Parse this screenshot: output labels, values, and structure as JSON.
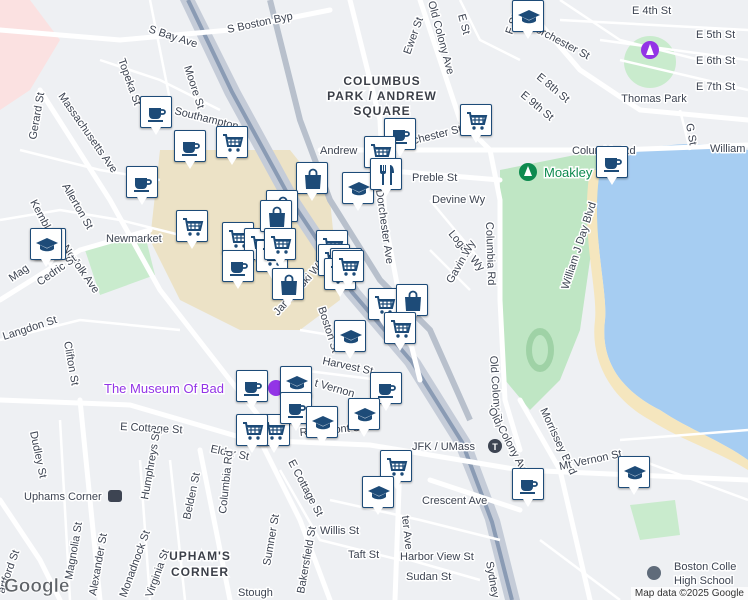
{
  "map": {
    "attribution": "Map data ©2025 Google",
    "logo": "Google",
    "areas": [
      {
        "id": "columbus-park-line1",
        "text": "COLUMBUS"
      },
      {
        "id": "columbus-park-line2",
        "text": "PARK / ANDREW"
      },
      {
        "id": "columbus-park-line3",
        "text": "SQUARE"
      },
      {
        "id": "uphams-corner",
        "text": "UPHAM'S"
      },
      {
        "id": "uphams-corner-2",
        "text": "CORNER"
      }
    ],
    "pois": [
      {
        "id": "museum",
        "text": "The Museum Of Bad",
        "color": "#9334e6"
      },
      {
        "id": "moakley",
        "text": "Moakley",
        "color": "#0d8a4f"
      },
      {
        "id": "thomas-park",
        "text": "Thomas Park",
        "color": "#3d4452"
      },
      {
        "id": "jfk-umass",
        "text": "JFK / UMass",
        "color": "#3d4452"
      },
      {
        "id": "uphams-corner-station",
        "text": "Uphams Corner",
        "color": "#3d4452"
      },
      {
        "id": "boston-college-hs-1",
        "text": "Boston Colle",
        "color": "#3d4452"
      },
      {
        "id": "boston-college-hs-2",
        "text": "High School",
        "color": "#3d4452"
      }
    ],
    "streets": [
      {
        "id": "s-bay-ave",
        "text": "S Bay Ave"
      },
      {
        "id": "s-boston-byp",
        "text": "S Boston Byp"
      },
      {
        "id": "old-colony-ave-top",
        "text": "Old Colony Ave"
      },
      {
        "id": "e-st",
        "text": "E St"
      },
      {
        "id": "ewer-st",
        "text": "Ewer St"
      },
      {
        "id": "f-st",
        "text": "F St"
      },
      {
        "id": "e-4th-st",
        "text": "E 4th St"
      },
      {
        "id": "e-5th-st",
        "text": "E 5th St"
      },
      {
        "id": "e-6th-st",
        "text": "E 6th St"
      },
      {
        "id": "e-7th-st",
        "text": "E 7th St"
      },
      {
        "id": "dorchester-st",
        "text": "Dorchester St"
      },
      {
        "id": "e-8th-st",
        "text": "E 8th St"
      },
      {
        "id": "e-9th-st",
        "text": "E 9th St"
      },
      {
        "id": "topeka-st",
        "text": "Topeka St"
      },
      {
        "id": "moore-st",
        "text": "Moore St"
      },
      {
        "id": "southampton-st",
        "text": "Southampton"
      },
      {
        "id": "gerard-st",
        "text": "Gerard St"
      },
      {
        "id": "massachusetts-ave",
        "text": "Massachusetts Ave"
      },
      {
        "id": "allerton-st",
        "text": "Allerton St"
      },
      {
        "id": "kemble-st",
        "text": "Kemble St"
      },
      {
        "id": "newmarket",
        "text": "Newmarket"
      },
      {
        "id": "norfolk-ave",
        "text": "Norfolk Ave"
      },
      {
        "id": "magazine-st",
        "text": "Mag"
      },
      {
        "id": "cedric-st",
        "text": "Cedric St"
      },
      {
        "id": "langdon-st",
        "text": "Langdon St"
      },
      {
        "id": "clifton-st",
        "text": "Clifton St"
      },
      {
        "id": "dudley-st",
        "text": "Dudley St"
      },
      {
        "id": "andrew-sq",
        "text": "Andrew"
      },
      {
        "id": "dorchester-st-2",
        "text": "chester St"
      },
      {
        "id": "preble-st",
        "text": "Preble St"
      },
      {
        "id": "devine-wy",
        "text": "Devine Wy"
      },
      {
        "id": "logan-wy",
        "text": "Logan Wy"
      },
      {
        "id": "gavin-wy",
        "text": "Gavin Wy"
      },
      {
        "id": "dorchester-ave",
        "text": "Dorchester Ave"
      },
      {
        "id": "columbia-rd",
        "text": "Columbia Rd"
      },
      {
        "id": "columbia-rd-top",
        "text": "Columbia Rd"
      },
      {
        "id": "william-j-day-blvd",
        "text": "William J Day Blvd"
      },
      {
        "id": "william-j-day-blvd-2",
        "text": "William"
      },
      {
        "id": "g-st",
        "text": "G St"
      },
      {
        "id": "old-colony-rd",
        "text": "Old Colony Rd"
      },
      {
        "id": "old-colony-ave",
        "text": "Old Colony Ave"
      },
      {
        "id": "morrissey-blvd",
        "text": "Morrissey Blvd"
      },
      {
        "id": "mt-vernon-st",
        "text": "Mt Vernon St"
      },
      {
        "id": "jan-karski-way",
        "text": "Jan Karski Way"
      },
      {
        "id": "boston-st",
        "text": "Boston St"
      },
      {
        "id": "harvest-st",
        "text": "Harvest St"
      },
      {
        "id": "mt-vernon-2",
        "text": "t Vernon"
      },
      {
        "id": "e-cottage-st",
        "text": "E Cottage St"
      },
      {
        "id": "e-cottage-st-2",
        "text": "E Cottage St"
      },
      {
        "id": "elder-st",
        "text": "Elder St"
      },
      {
        "id": "rosemont-st",
        "text": "Rosemont St"
      },
      {
        "id": "humphreys-st",
        "text": "Humphreys St"
      },
      {
        "id": "belden-st",
        "text": "Belden St"
      },
      {
        "id": "columbia-rd-2",
        "text": "Columbia Rd"
      },
      {
        "id": "sumner-st",
        "text": "Sumner St"
      },
      {
        "id": "bakersfield-st",
        "text": "Bakersfield St"
      },
      {
        "id": "willis-st",
        "text": "Willis St"
      },
      {
        "id": "taft-st",
        "text": "Taft St"
      },
      {
        "id": "harbor-view-st",
        "text": "Harbor View St"
      },
      {
        "id": "sudan-st",
        "text": "Sudan St"
      },
      {
        "id": "crescent-ave",
        "text": "Crescent Ave"
      },
      {
        "id": "dorchester-ave-2",
        "text": "ter Ave"
      },
      {
        "id": "magnolia-st",
        "text": "Magnolia St"
      },
      {
        "id": "alexander-st",
        "text": "Alexander St"
      },
      {
        "id": "monadnock-st",
        "text": "Monadnock St"
      },
      {
        "id": "virginia-st",
        "text": "Virginia St"
      },
      {
        "id": "hartford-st",
        "text": "artford St"
      },
      {
        "id": "stoughton-st",
        "text": "Stough"
      },
      {
        "id": "sydney-st",
        "text": "Sydney"
      }
    ],
    "markers": [
      {
        "id": "m1",
        "icon": "school-icon"
      },
      {
        "id": "m2",
        "icon": "cafe-icon"
      },
      {
        "id": "m3",
        "icon": "grocery-cart-icon"
      },
      {
        "id": "m4",
        "icon": "cafe-icon"
      },
      {
        "id": "m5",
        "icon": "cafe-icon"
      },
      {
        "id": "m6",
        "icon": "school-icon"
      },
      {
        "id": "m7",
        "icon": "grocery-cart-icon"
      },
      {
        "id": "m8",
        "icon": "shopping-bag-icon"
      },
      {
        "id": "m9",
        "icon": "shopping-bag-icon"
      },
      {
        "id": "m10",
        "icon": "grocery-cart-icon"
      },
      {
        "id": "m11",
        "icon": "grocery-cart-icon"
      },
      {
        "id": "m12",
        "icon": "grocery-cart-icon"
      },
      {
        "id": "m13",
        "icon": "cafe-icon"
      },
      {
        "id": "m14",
        "icon": "grocery-cart-icon"
      },
      {
        "id": "m15",
        "icon": "shopping-bag-icon"
      },
      {
        "id": "m16",
        "icon": "shopping-bag-icon"
      },
      {
        "id": "m17",
        "icon": "school-icon"
      },
      {
        "id": "m18",
        "icon": "cafe-icon"
      },
      {
        "id": "m19",
        "icon": "grocery-cart-icon"
      },
      {
        "id": "m20",
        "icon": "restaurant-icon"
      },
      {
        "id": "m21",
        "icon": "grocery-cart-icon"
      },
      {
        "id": "m22",
        "icon": "grocery-cart-icon"
      },
      {
        "id": "m23",
        "icon": "grocery-cart-icon"
      },
      {
        "id": "m24",
        "icon": "grocery-cart-icon"
      },
      {
        "id": "m25",
        "icon": "grocery-cart-icon"
      },
      {
        "id": "m26",
        "icon": "grocery-cart-icon"
      },
      {
        "id": "m27",
        "icon": "shopping-bag-icon"
      },
      {
        "id": "m28",
        "icon": "grocery-cart-icon"
      },
      {
        "id": "m29",
        "icon": "school-icon"
      },
      {
        "id": "m30",
        "icon": "grocery-cart-icon"
      },
      {
        "id": "m31",
        "icon": "school-icon"
      },
      {
        "id": "m32",
        "icon": "cafe-icon"
      },
      {
        "id": "m33",
        "icon": "cafe-icon"
      },
      {
        "id": "m34",
        "icon": "cafe-icon"
      },
      {
        "id": "m35",
        "icon": "school-icon"
      },
      {
        "id": "m36",
        "icon": "school-icon"
      },
      {
        "id": "m37",
        "icon": "grocery-cart-icon"
      },
      {
        "id": "m38",
        "icon": "grocery-cart-icon"
      },
      {
        "id": "m39",
        "icon": "school-icon"
      },
      {
        "id": "m40",
        "icon": "cafe-icon"
      },
      {
        "id": "m41",
        "icon": "school-icon"
      },
      {
        "id": "m42",
        "icon": "cafe-icon"
      },
      {
        "id": "m43",
        "icon": "school-icon"
      },
      {
        "id": "m44",
        "icon": "grocery-cart-icon"
      }
    ]
  }
}
